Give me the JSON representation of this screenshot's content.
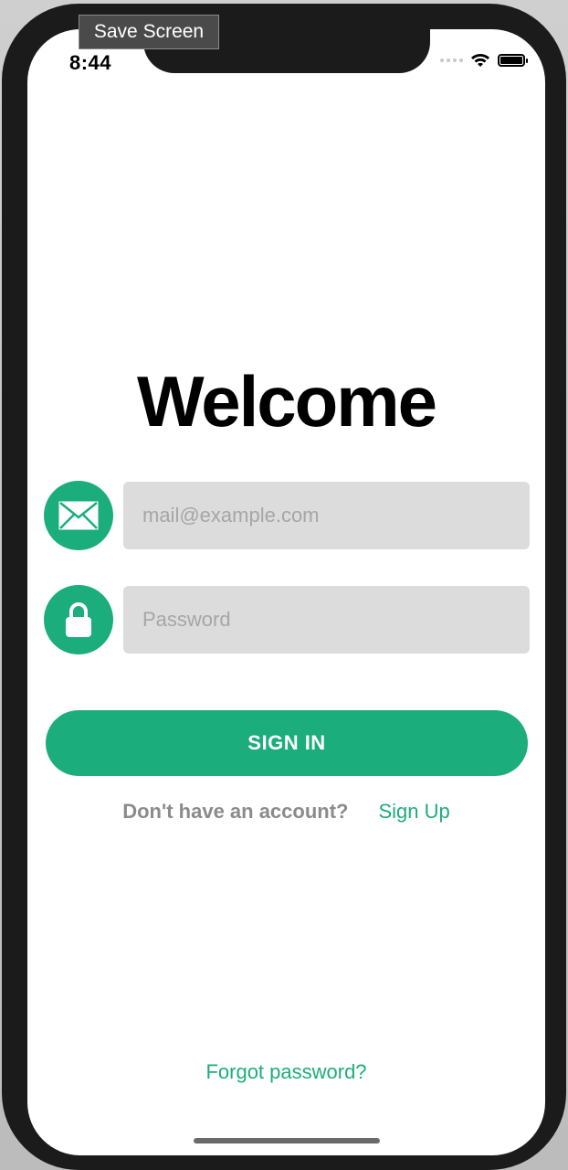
{
  "toolbar": {
    "save_screen_label": "Save Screen"
  },
  "status_bar": {
    "time": "8:44"
  },
  "main": {
    "title": "Welcome",
    "email": {
      "value": "",
      "placeholder": "mail@example.com"
    },
    "password": {
      "value": "",
      "placeholder": "Password"
    },
    "sign_in_label": "SIGN IN",
    "no_account_text": "Don't have an account?",
    "sign_up_label": "Sign Up",
    "forgot_password_label": "Forgot password?"
  },
  "icons": {
    "email": "envelope-icon",
    "password": "lock-icon",
    "wifi": "wifi-icon",
    "battery": "battery-icon",
    "cellular": "cellular-icon"
  },
  "colors": {
    "accent": "#1bad7b",
    "input_background": "#dcdcdc",
    "muted_text": "#8b8b8b"
  }
}
